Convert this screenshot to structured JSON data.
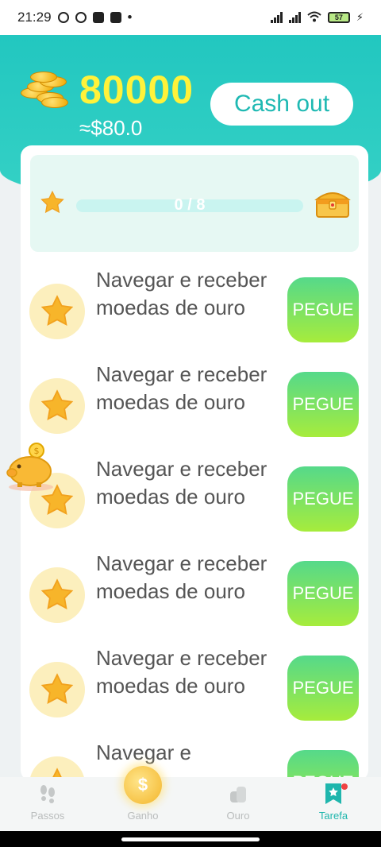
{
  "status_bar": {
    "time": "21:29",
    "battery": "57"
  },
  "header": {
    "coin_balance": "80000",
    "usd_value": "≈$80.0",
    "cashout_label": "Cash out"
  },
  "progress": {
    "text": "0 / 8",
    "done": 0,
    "total": 8
  },
  "tasks": [
    {
      "label": "Navegar e receber moedas de ouro",
      "button": "PEGUE",
      "icon": "star-icon"
    },
    {
      "label": "Navegar e receber moedas de ouro",
      "button": "PEGUE",
      "icon": "star-icon"
    },
    {
      "label": "Navegar e receber moedas de ouro",
      "button": "PEGUE",
      "icon": "star-icon"
    },
    {
      "label": "Navegar e receber moedas de ouro",
      "button": "PEGUE",
      "icon": "star-icon"
    },
    {
      "label": "Navegar e receber moedas de ouro",
      "button": "PEGUE",
      "icon": "star-icon"
    },
    {
      "label": "Navegar e",
      "button": "PEGUE",
      "icon": "star-icon"
    }
  ],
  "nav": {
    "items": [
      {
        "label": "Passos",
        "icon": "footprints-icon",
        "active": false
      },
      {
        "label": "Ganho",
        "icon": "dollar-coin-icon",
        "active": false
      },
      {
        "label": "Ouro",
        "icon": "coin-stack-icon",
        "active": false
      },
      {
        "label": "Tarefa",
        "icon": "bookmark-star-icon",
        "active": true
      }
    ]
  },
  "colors": {
    "accent": "#22c7c0",
    "balance": "#fff23a",
    "button_gradient_top": "#55d98a",
    "button_gradient_bottom": "#a6ec3c",
    "star": "#f7b52a"
  }
}
